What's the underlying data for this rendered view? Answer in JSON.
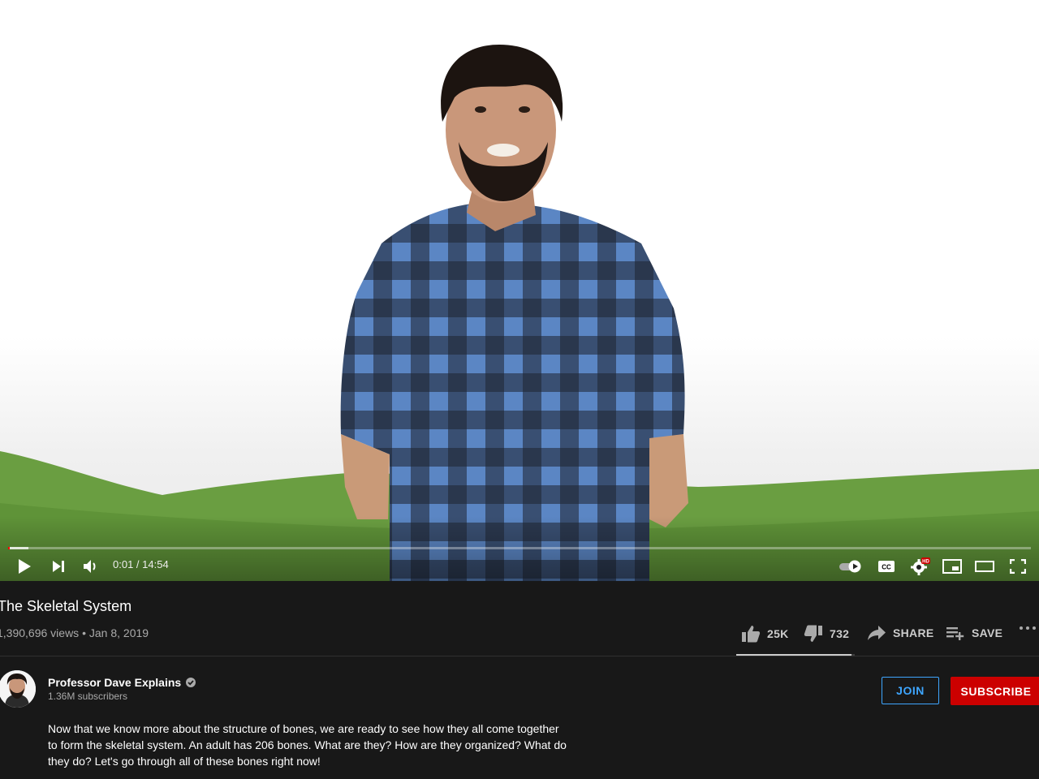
{
  "player": {
    "time_current": "0:01",
    "time_separator": " / ",
    "time_total": "14:54",
    "progress_fraction": 0.0011,
    "buffered_fraction": 0.02,
    "controls": {
      "play": "play-icon",
      "next": "next-icon",
      "volume": "volume-icon",
      "autoplay": "autoplay-toggle-icon",
      "captions": "captions-icon",
      "settings": "settings-icon",
      "settings_badge": "HD",
      "miniplayer": "miniplayer-icon",
      "theater": "theater-mode-icon",
      "fullscreen": "fullscreen-icon"
    }
  },
  "video": {
    "title": "The Skeletal System",
    "views": "1,390,696 views",
    "meta_separator": " • ",
    "date": "Jan 8, 2019"
  },
  "actions": {
    "like_count": "25K",
    "dislike_count": "732",
    "share_label": "SHARE",
    "save_label": "SAVE",
    "more": "more-icon",
    "like_fraction": 0.97
  },
  "channel": {
    "name": "Professor Dave Explains",
    "subscribers": "1.36M subscribers",
    "join_label": "JOIN",
    "subscribe_label": "SUBSCRIBE",
    "verified_icon": "verified-check-icon"
  },
  "description": {
    "text": "Now that we know more about the structure of bones, we are ready to see how they all come together to form the skeletal system. An adult has 206 bones. What are they? How are they organized? What do they do? Let's go through all of these bones right now!"
  },
  "colors": {
    "accent_red": "#cc0000",
    "join_blue": "#3ea6ff",
    "background": "#181818",
    "grass_green": "#6a9e41",
    "shirt_blue": "#4a72b0"
  }
}
